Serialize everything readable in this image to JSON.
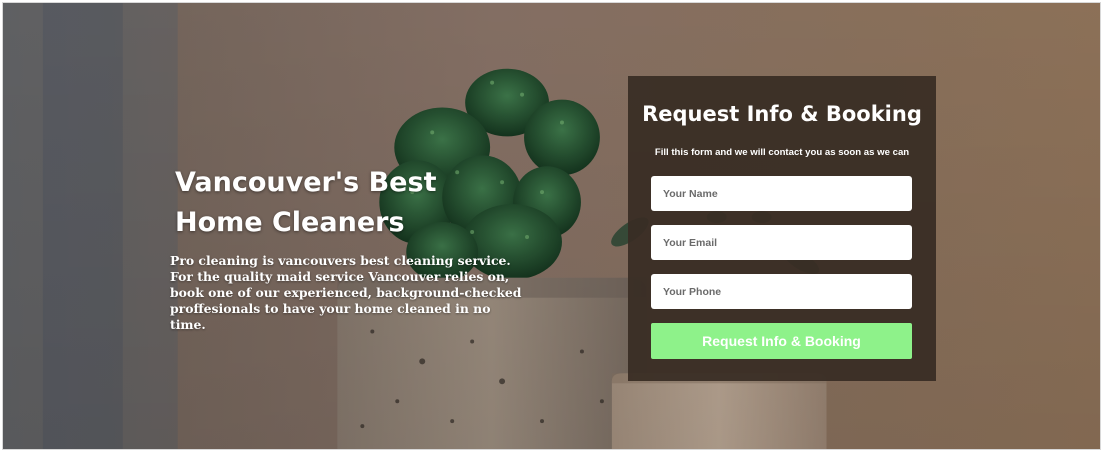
{
  "hero": {
    "headline": "Vancouver's Best Home Cleaners",
    "description": "Pro cleaning is vancouvers best cleaning service. For the quality maid service Vancouver relies on, book one of our experienced, background-checked proffesionals to have your home cleaned in no time."
  },
  "form": {
    "title": "Request Info & Booking",
    "subtitle": "Fill this form and we will contact you as soon as we can",
    "name_placeholder": "Your Name",
    "email_placeholder": "Your Email",
    "phone_placeholder": "Your Phone",
    "submit_label": "Request Info & Booking"
  },
  "colors": {
    "form_background": "#382c24",
    "submit_button": "#8ef28a"
  },
  "background_image": {
    "subject": "cactus plants in concrete pots"
  }
}
